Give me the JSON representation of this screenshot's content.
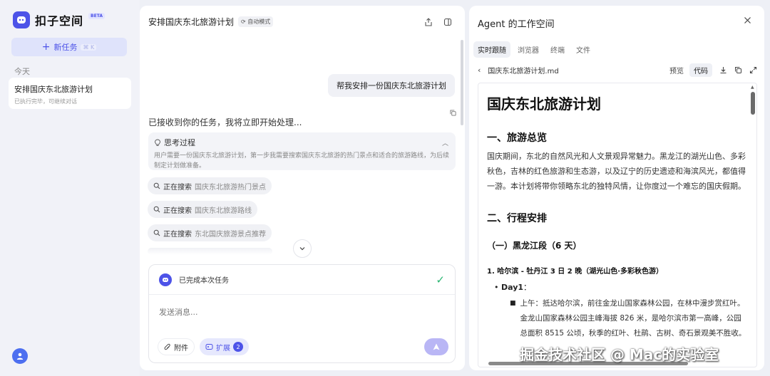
{
  "app": {
    "logo_mark": "◡",
    "name": "扣子空间",
    "badge": "BETA"
  },
  "sidebar": {
    "new_task": "新任务",
    "new_task_kbd": "⌘ K",
    "section_today": "今天",
    "task_title": "安排国庆东北旅游计划",
    "task_subtitle": "已执行完毕，可继续对话"
  },
  "chat": {
    "title": "安排国庆东北旅游计划",
    "mode": "自动模式",
    "user_message": "帮我安排一份国庆东北旅游计划",
    "ack": "已接收到你的任务，我将立即开始处理...",
    "thinking_title": "思考过程",
    "thinking_body": "用户需要一份国庆东北旅游计划，第一步我需要搜索国庆东北旅游的热门景点和适合的旅游路线，为后续制定计划做准备。",
    "searching_label": "正在搜索",
    "searches": [
      "国庆东北旅游热门景点",
      "国庆东北旅游路线",
      "东北国庆旅游景点推荐"
    ],
    "status": "已完成本次任务",
    "input_placeholder": "发送消息...",
    "attach": "附件",
    "extend": "扩展",
    "extend_count": "2"
  },
  "agent": {
    "title": "Agent 的工作空间",
    "tabs": [
      "实时跟随",
      "浏览器",
      "终端",
      "文件"
    ],
    "file_name": "国庆东北旅游计划.md",
    "preview": "预览",
    "code": "代码",
    "doc": {
      "h1": "国庆东北旅游计划",
      "h2_1": "一、旅游总览",
      "p1": "国庆期间，东北的自然风光和人文景观异常魅力。黑龙江的湖光山色、多彩秋色，吉林的红色旅游和生态游，以及辽宁的历史遗迹和海滨风光，都值得一游。本计划将带你领略东北的独特风情，让你度过一个难忘的国庆假期。",
      "h2_2": "二、行程安排",
      "h3_1": "（一）黑龙江段（6 天）",
      "h4_1": "1. 哈尔滨 - 牡丹江 3 日 2 晚（湖光山色·多彩秋色游）",
      "day": "Day1",
      "colon": "：",
      "item": "上午：抵达哈尔滨，前往金龙山国家森林公园，在林中漫步赏红叶。金龙山国家森林公园主峰海拔 826 米，是哈尔滨市第一高峰，公园总面积 8515 公顷，秋季的红叶、杜鹃、古树、奇石景观美不胜收。"
    }
  },
  "watermark": "掘金技术社区 @ Mac的实验室",
  "colors": {
    "accent": "#4d53e8",
    "success": "#2bb673",
    "background": "#eef0f6"
  }
}
